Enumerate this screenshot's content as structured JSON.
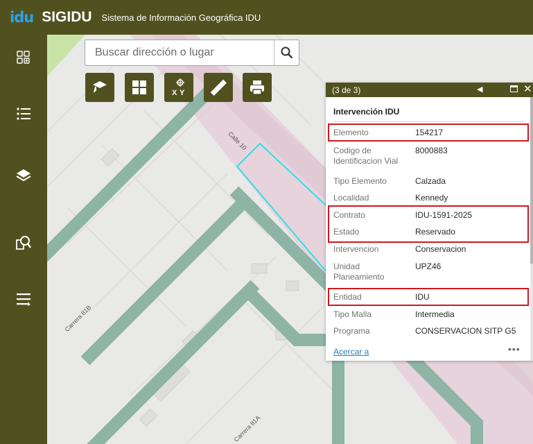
{
  "header": {
    "logo": "idu",
    "app_name": "SIGIDU",
    "subtitle": "Sistema de Información Geográfica IDU"
  },
  "sidebar": {
    "items": [
      {
        "icon": "widgets-grid-icon"
      },
      {
        "icon": "list-icon"
      },
      {
        "icon": "layers-icon"
      },
      {
        "icon": "query-search-icon"
      },
      {
        "icon": "menu-icon"
      }
    ]
  },
  "search": {
    "placeholder": "Buscar dirección o lugar",
    "value": ""
  },
  "tools": [
    {
      "icon": "graduation-cap-icon"
    },
    {
      "icon": "basemap-gallery-icon"
    },
    {
      "icon": "xy-coordinate-icon"
    },
    {
      "icon": "ruler-measure-icon"
    },
    {
      "icon": "print-icon"
    }
  ],
  "map": {
    "streets": [
      "Calle 10",
      "Carrera 81B",
      "Carrera 81A"
    ]
  },
  "popup": {
    "count": "(3 de 3)",
    "title": "Intervención IDU",
    "attributes": [
      {
        "label": "Elemento",
        "value": "154217",
        "highlighted": true
      },
      {
        "label": "Codigo de Identificacion Vial",
        "value": "8000883",
        "highlighted": false
      },
      {
        "label": "Tipo Elemento",
        "value": "Calzada",
        "highlighted": false
      },
      {
        "label": "Localidad",
        "value": "Kennedy",
        "highlighted": false
      },
      {
        "label": "Contrato",
        "value": "IDU-1591-2025",
        "highlighted": true
      },
      {
        "label": "Estado",
        "value": "Reservado",
        "highlighted": true
      },
      {
        "label": "Intervencion",
        "value": "Conservacion",
        "highlighted": false
      },
      {
        "label": "Unidad Planeamiento",
        "value": "UPZ46",
        "highlighted": false
      },
      {
        "label": "Entidad",
        "value": "IDU",
        "highlighted": true
      },
      {
        "label": "Tipo Malla",
        "value": "Intermedia",
        "highlighted": false
      },
      {
        "label": "Programa",
        "value": "CONSERVACION SITP G5",
        "highlighted": false
      }
    ],
    "footer_link": "Acercar a",
    "more": "•••"
  },
  "colors": {
    "brand": "#515120",
    "highlight_border": "#d0181d",
    "selection_outline": "#2fe0e8",
    "road_green": "#8db4a4",
    "arterial_pink": "#e6d3dc",
    "link": "#1f7fc5"
  }
}
